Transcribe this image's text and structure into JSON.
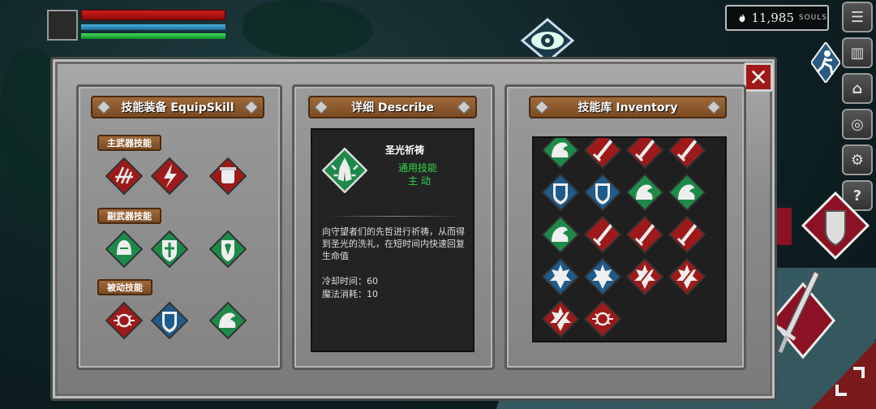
{
  "hud": {
    "souls_value": "11,985",
    "souls_unit": "SOULS",
    "hp_color": "#d01c1c",
    "mp_color": "#4ab4e0",
    "stamina_color": "#3edc5a"
  },
  "side_menu": [
    {
      "icon": "menu-list-icon",
      "glyph": "☰"
    },
    {
      "icon": "book-icon",
      "glyph": "▥"
    },
    {
      "icon": "door-icon",
      "glyph": "⌂"
    },
    {
      "icon": "medal-icon",
      "glyph": "◎"
    },
    {
      "icon": "gear-icon",
      "glyph": "⚙"
    },
    {
      "icon": "help-icon",
      "glyph": "?"
    }
  ],
  "panels": {
    "equip_title": "技能装备 EquipSkill",
    "describe_title": "详细 Describe",
    "inventory_title": "技能库 Inventory"
  },
  "equip": {
    "main_weapon_label": "主武器技能",
    "sub_weapon_label": "副武器技能",
    "passive_label": "被动技能",
    "main_weapon_skills": [
      "claw-slash-icon",
      "lightning-blade-icon",
      "fire-pot-icon"
    ],
    "sub_weapon_skills": [
      "helmet-icon",
      "holy-cross-shield-icon",
      "holy-shield-icon"
    ],
    "passive_skills": [
      "spine-aura-icon",
      "blue-shield-icon",
      "muscle-arm-icon"
    ]
  },
  "describe": {
    "skill_name": "圣光祈祷",
    "skill_type": "通用技能",
    "skill_mode": "主 动",
    "description": "向守望者们的先哲进行祈祷，从而得到圣光的洗礼，在短时间内快速回复生命值",
    "cooldown": "冷却时间：60",
    "mana_cost": "魔法消耗：10"
  },
  "inventory": {
    "rows": [
      [
        "muscle-arm-icon",
        "sword-icon",
        "sword-icon",
        "sword-icon"
      ],
      [
        "blue-shield-icon",
        "blue-shield-icon",
        "muscle-arm-icon",
        "muscle-arm-icon"
      ],
      [
        "muscle-arm-icon",
        "sword-icon",
        "sword-icon",
        "sword-icon"
      ],
      [
        "spiky-shield-icon",
        "spiky-shield-icon",
        "burst-sword-icon",
        "burst-sword-icon"
      ],
      [
        "burst-sword-icon",
        "spine-aura-icon"
      ]
    ]
  },
  "colors": {
    "skill_red": "#9e1a1a",
    "skill_green": "#1e8a4a",
    "skill_blue": "#1e5a8a",
    "wood": "#8a5a2e",
    "stone": "#8c8c8c"
  }
}
